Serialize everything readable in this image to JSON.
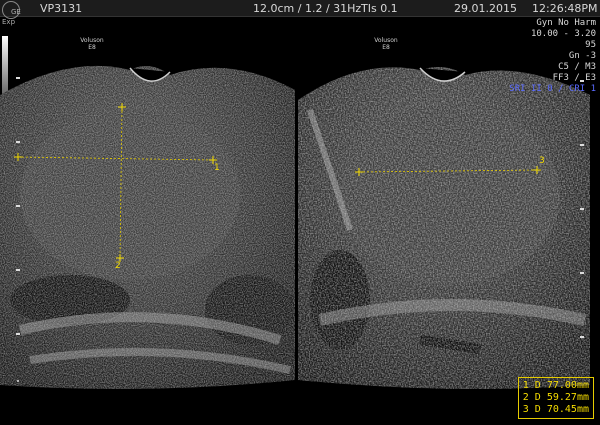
{
  "header": {
    "logo": "GE",
    "logo_sub": "Exp",
    "logo_tag": "LG",
    "patient_id": "VP3131",
    "imaging": "12.0cm / 1.2 / 31Hz",
    "tis": "TIs  0.1",
    "date": "29.01.2015",
    "time": "12:26:48PM"
  },
  "params": {
    "line1": "Gyn No Harm",
    "line2": "10.00 - 3.20",
    "line3": "95",
    "line4": "Gn  -3",
    "line5": "C5 / M3",
    "line6": "FF3 / E3",
    "line7": "SRI II 0 / CRI 1"
  },
  "left_image": {
    "probe_line1": "Voluson",
    "probe_line2": "E8"
  },
  "right_image": {
    "probe_line1": "Voluson",
    "probe_line2": "E8"
  },
  "measurements": {
    "m1": "1  D 77.00mm",
    "m2": "2  D 59.27mm",
    "m3": "3  D 70.45mm"
  },
  "caliper_labels": {
    "c1": "1",
    "c2": "2",
    "c3": "3"
  },
  "colors": {
    "caliper": "#f5dc00",
    "accent_blue": "#5a6bff",
    "background": "#000000"
  }
}
